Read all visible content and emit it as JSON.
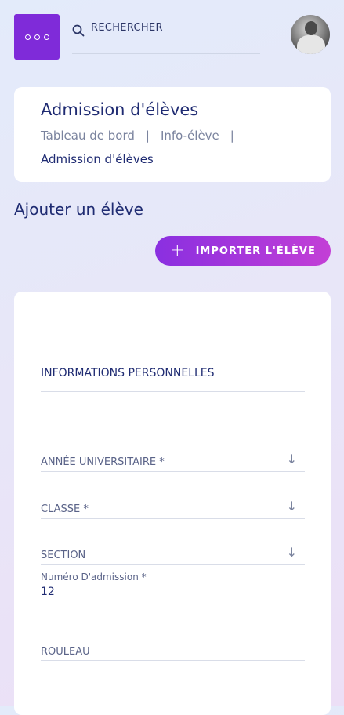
{
  "header": {
    "menu_icon": "more-horizontal-icon",
    "search_icon": "search-icon",
    "search_label": "RECHERCHER",
    "avatar_icon": "user-avatar"
  },
  "page": {
    "title": "Admission d'élèves",
    "breadcrumb": {
      "items": [
        "Tableau de bord",
        "|",
        "Info-élève",
        "|"
      ],
      "last": "Admission d'élèves"
    },
    "section_title": "Ajouter un élève",
    "import_button": {
      "icon": "+",
      "label": "IMPORTER L'ÉLÈVE"
    }
  },
  "form": {
    "section_heading": "INFORMATIONS PERSONNELLES",
    "fields": [
      {
        "label": "ANNÉE UNIVERSITAIRE *",
        "arrow": "↓"
      },
      {
        "label": "CLASSE *",
        "arrow": "↓"
      },
      {
        "label": "SECTION",
        "arrow": "↓"
      }
    ],
    "admission_number": {
      "label": "Numéro D'admission *",
      "value": "12"
    },
    "rouleau": {
      "label": "ROULEAU"
    }
  },
  "colors": {
    "primary": "#7f2bd9",
    "accent_end": "#c33fd6",
    "text_dark": "#1f2b72"
  }
}
